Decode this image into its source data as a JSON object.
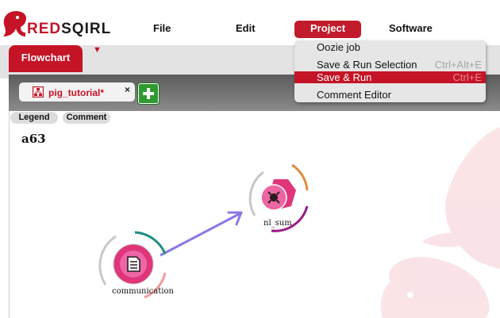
{
  "app": {
    "logo_word_red": "RED",
    "logo_word_dark": "SQIRL",
    "brand_color": "#c41426"
  },
  "menu": {
    "items": [
      {
        "label": "File"
      },
      {
        "label": "Edit"
      },
      {
        "label": "Project"
      },
      {
        "label": "Software"
      }
    ],
    "active": "Project"
  },
  "tabs": {
    "main_tab": "Flowchart",
    "dropdown_icon": "triangle-down-icon"
  },
  "workspace": {
    "file_tab": "pig_tutorial*",
    "close_symbol": "×",
    "add_icon": "plus-icon"
  },
  "canvas": {
    "legend_label": "Legend",
    "comment_label": "Comment",
    "title": "a63",
    "nodes": [
      {
        "label": "nl_sum",
        "icon": "collapse-arrows-icon"
      },
      {
        "label": "communication",
        "icon": "document-icon"
      }
    ]
  },
  "project_menu": {
    "items": [
      {
        "label": "Oozie job",
        "shortcut": ""
      },
      {
        "label": "Save & Run Selection",
        "shortcut": "Ctrl+Alt+E"
      },
      {
        "label": "Save & Run",
        "shortcut": "Ctrl+E"
      },
      {
        "label": "Comment Editor",
        "shortcut": ""
      }
    ],
    "selected": "Save & Run"
  }
}
